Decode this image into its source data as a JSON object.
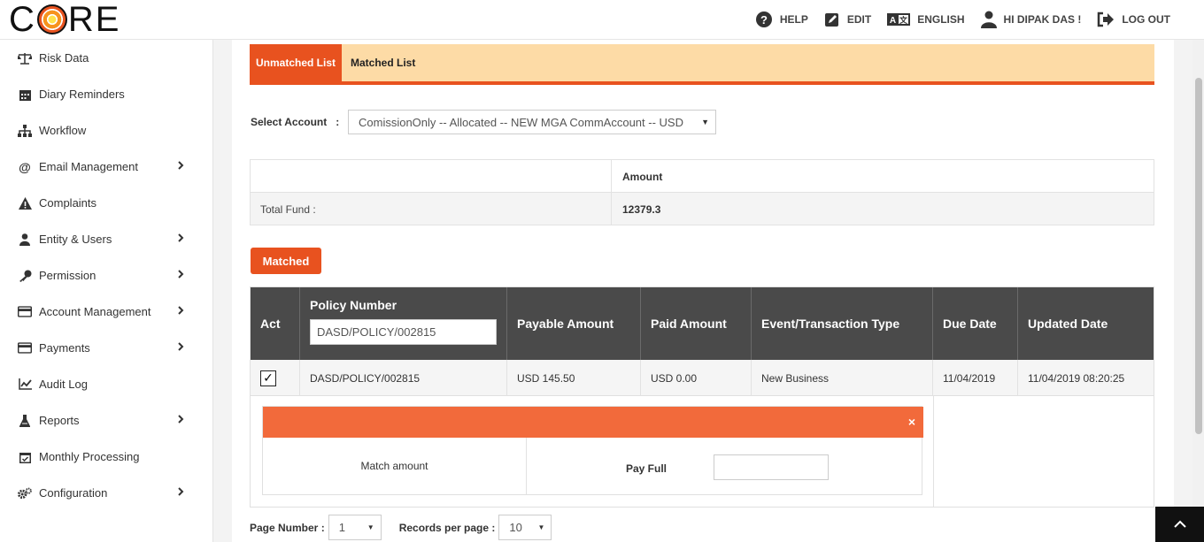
{
  "app": {
    "logo_text_left": "C",
    "logo_text_right": "RE"
  },
  "topnav": {
    "help": "HELP",
    "edit": "EDIT",
    "language": "ENGLISH",
    "user": "HI DIPAK DAS !",
    "logout": "LOG OUT"
  },
  "sidebar": {
    "items": [
      {
        "label": "Risk Data",
        "icon": "balance-scale-icon",
        "has_submenu": false
      },
      {
        "label": "Diary Reminders",
        "icon": "calendar-icon",
        "has_submenu": false
      },
      {
        "label": "Workflow",
        "icon": "sitemap-icon",
        "has_submenu": false
      },
      {
        "label": "Email Management",
        "icon": "at-icon",
        "has_submenu": true
      },
      {
        "label": "Complaints",
        "icon": "warning-icon",
        "has_submenu": false
      },
      {
        "label": "Entity & Users",
        "icon": "user-icon",
        "has_submenu": true
      },
      {
        "label": "Permission",
        "icon": "key-icon",
        "has_submenu": true
      },
      {
        "label": "Account Management",
        "icon": "card-icon",
        "has_submenu": true
      },
      {
        "label": "Payments",
        "icon": "payment-icon",
        "has_submenu": true
      },
      {
        "label": "Audit Log",
        "icon": "line-chart-icon",
        "has_submenu": false
      },
      {
        "label": "Reports",
        "icon": "flask-icon",
        "has_submenu": true
      },
      {
        "label": "Monthly Processing",
        "icon": "calendar-check-icon",
        "has_submenu": false
      },
      {
        "label": "Configuration",
        "icon": "cogs-icon",
        "has_submenu": true
      }
    ]
  },
  "tabs": [
    {
      "label": "Unmatched List",
      "active": true
    },
    {
      "label": "Matched List",
      "active": false
    }
  ],
  "select_account": {
    "label": "Select Account",
    "separator": ":",
    "value": "ComissionOnly -- Allocated -- NEW MGA CommAccount -- USD"
  },
  "fund_table": {
    "amount_header": "Amount",
    "total_fund_label": "Total Fund :",
    "total_fund_value": "12379.3"
  },
  "matched_button": "Matched",
  "grid": {
    "columns": [
      "Act",
      "Policy Number",
      "Payable Amount",
      "Paid Amount",
      "Event/Transaction Type",
      "Due Date",
      "Updated Date"
    ],
    "policy_filter_value": "DASD/POLICY/002815",
    "rows": [
      {
        "checked": true,
        "check_glyph": "✓",
        "policy_number": "DASD/POLICY/002815",
        "payable_amount": "USD 145.50",
        "paid_amount": "USD 0.00",
        "event_type": "New Business",
        "due_date": "11/04/2019",
        "updated_date": "11/04/2019 08:20:25"
      }
    ],
    "detail_panel": {
      "close_glyph": "×",
      "match_amount_label": "Match amount",
      "pay_full_label": "Pay Full",
      "pay_full_value": ""
    }
  },
  "pager": {
    "page_number_label": "Page Number :",
    "page_number_value": "1",
    "records_label": "Records per page :",
    "records_value": "10",
    "arrow_glyph": "▼"
  },
  "colors": {
    "accent": "#e8521f",
    "tab_bar": "#fddba6",
    "header_dark": "#4a4a4a",
    "panel_header": "#f26a3b"
  }
}
